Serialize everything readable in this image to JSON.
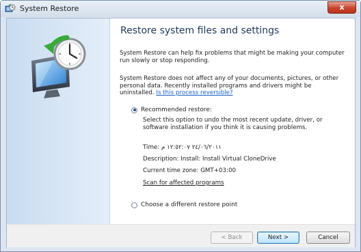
{
  "window": {
    "title": "System Restore",
    "close_label": "x"
  },
  "icons": {
    "title_icon": "system-restore-icon",
    "hero_icon": "system-restore-clock-monitor-icon",
    "close_icon": "close-icon"
  },
  "main": {
    "heading": "Restore system files and settings",
    "para1": "System Restore can help fix problems that might be making your computer run slowly or stop responding.",
    "para2_text": "System Restore does not affect any of your documents, pictures, or other personal data. Recently installed programs and drivers might be uninstalled.",
    "para2_link": "Is this process reversible?"
  },
  "recommended": {
    "label": "Recommended restore:",
    "selected": true,
    "description": "Select this option to undo the most recent update, driver, or software installation if you think it is causing problems.",
    "time": "Time: ٢٤/٠٦/٢٠١١ ١٢:٥٢:٠٧ م",
    "description_line": "Description: Install: Install Virtual CloneDrive",
    "timezone": "Current time zone: GMT+03:00",
    "scan_link": "Scan for affected programs"
  },
  "different": {
    "label": "Choose a different restore point",
    "selected": false
  },
  "buttons": {
    "back": "< Back",
    "next": "Next >",
    "cancel": "Cancel"
  },
  "colors": {
    "heading": "#1e395b",
    "link": "#1a5fc6",
    "close_button": "#c7442c"
  }
}
